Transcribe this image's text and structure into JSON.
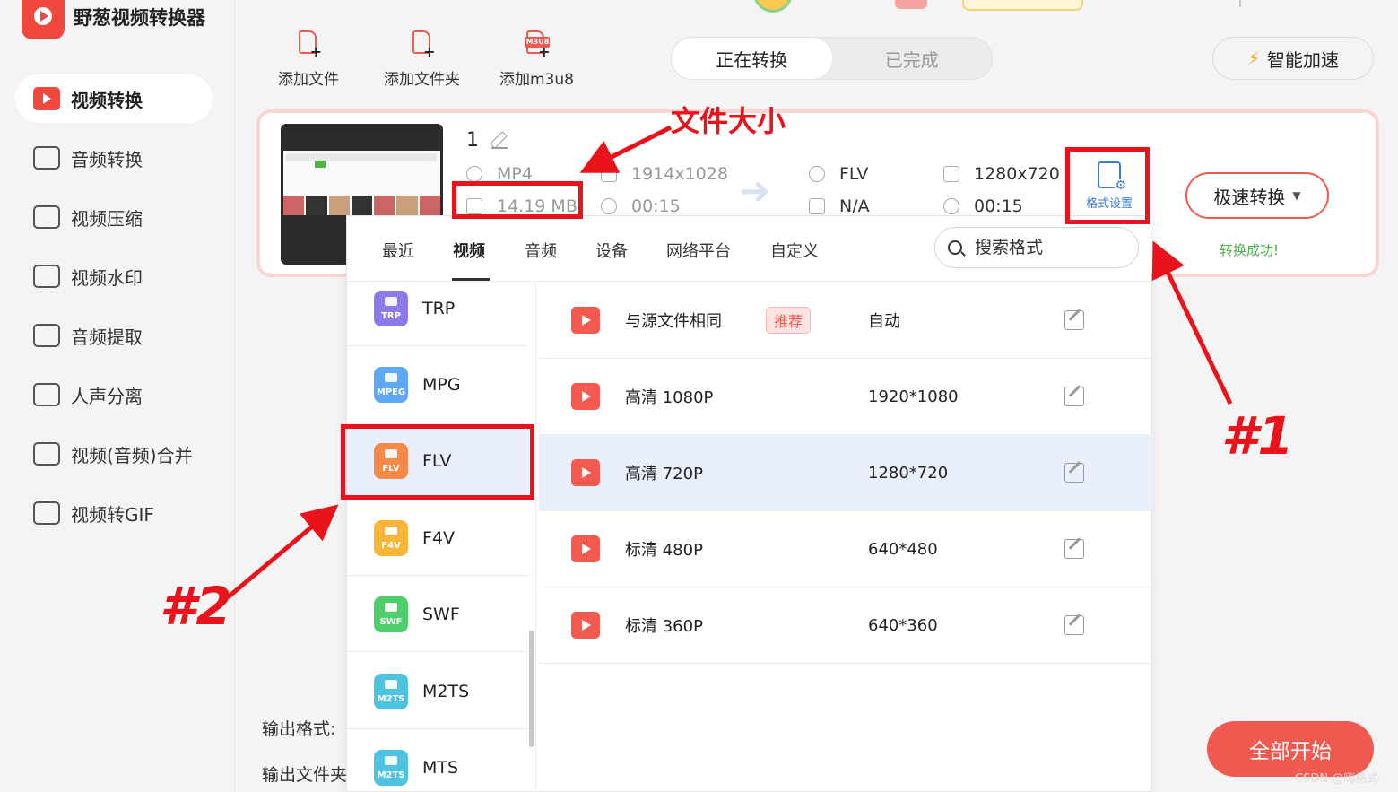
{
  "app": {
    "title": "野葱视频转换器"
  },
  "sidebar": {
    "items": [
      {
        "label": "视频转换",
        "active": true,
        "icon": "video-convert-icon"
      },
      {
        "label": "音频转换",
        "icon": "audio-convert-icon"
      },
      {
        "label": "视频压缩",
        "icon": "video-compress-icon"
      },
      {
        "label": "视频水印",
        "icon": "watermark-icon"
      },
      {
        "label": "音频提取",
        "icon": "audio-extract-icon"
      },
      {
        "label": "人声分离",
        "icon": "vocal-separate-icon"
      },
      {
        "label": "视频(音频)合并",
        "icon": "merge-icon"
      },
      {
        "label": "视频转GIF",
        "icon": "gif-icon"
      }
    ]
  },
  "toolbar": {
    "add_file": "添加文件",
    "add_folder": "添加文件夹",
    "add_m3u8": "添加m3u8",
    "m3u8_badge": "M3U8",
    "tab_converting": "正在转换",
    "tab_done": "已完成",
    "smart_accel": "智能加速"
  },
  "task": {
    "name": "1",
    "src_format": "MP4",
    "src_size": "14.19 MB",
    "src_resolution": "1914x1028",
    "src_duration": "00:15",
    "dst_format": "FLV",
    "dst_size": "N/A",
    "dst_resolution": "1280x720",
    "dst_duration": "00:15",
    "format_settings": "格式设置",
    "convert_mode": "极速转换",
    "status": "转换成功!"
  },
  "output": {
    "format_label": "输出格式:",
    "folder_label": "输出文件夹"
  },
  "start_all": "全部开始",
  "watermark": "CSDN @嗨格式",
  "format_panel": {
    "tabs": [
      "最近",
      "视频",
      "音频",
      "设备",
      "网络平台",
      "自定义"
    ],
    "active_tab": "视频",
    "search_placeholder": "搜索格式",
    "formats": [
      {
        "name": "TRP",
        "badge": "TRP",
        "color": "#8b7bea"
      },
      {
        "name": "MPG",
        "badge": "MPEG",
        "color": "#5fa8f5"
      },
      {
        "name": "FLV",
        "badge": "FLV",
        "color": "#f5894a",
        "selected": true
      },
      {
        "name": "F4V",
        "badge": "F4V",
        "color": "#f7b53a"
      },
      {
        "name": "SWF",
        "badge": "SWF",
        "color": "#4fcf6a"
      },
      {
        "name": "M2TS",
        "badge": "M2TS",
        "color": "#4dc3e0"
      },
      {
        "name": "MTS",
        "badge": "M2TS",
        "color": "#4dc3e0"
      }
    ],
    "presets": [
      {
        "name": "与源文件相同",
        "tag": "推荐",
        "resolution": "自动"
      },
      {
        "name": "高清 1080P",
        "resolution": "1920*1080"
      },
      {
        "name": "高清 720P",
        "resolution": "1280*720",
        "selected": true
      },
      {
        "name": "标清 480P",
        "resolution": "640*480"
      },
      {
        "name": "标清 360P",
        "resolution": "640*360"
      }
    ]
  },
  "annotations": {
    "file_size_label": "文件大小",
    "marker_1": "#1",
    "marker_2": "#2",
    "color": "#e8131b"
  }
}
